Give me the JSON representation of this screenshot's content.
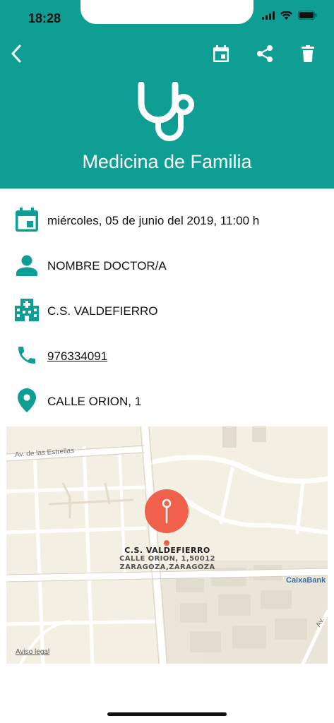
{
  "status_bar": {
    "time": "18:28"
  },
  "header": {
    "title": "Medicina de Familia",
    "background_color": "#0e9e94",
    "actions": {
      "back_icon": "chevron-left-icon",
      "calendar_icon": "calendar-event-icon",
      "share_icon": "share-icon",
      "delete_icon": "trash-icon"
    },
    "logo_icon": "stethoscope-icon"
  },
  "details": {
    "datetime": "miércoles, 05 de junio del 2019, 11:00 h",
    "doctor": "NOMBRE DOCTOR/A",
    "center": "C.S. VALDEFIERRO",
    "phone": "976334091",
    "address": "CALLE ORION, 1",
    "icon_color": "#0e9e94"
  },
  "map": {
    "street_label": "Av. de las Estrellas",
    "pin_title": "C.S. VALDEFIERRO",
    "pin_address_line1": "CALLE ORION, 1,50012",
    "pin_address_line2": "ZARAGOZA,ZARAGOZA",
    "poi_label": "CaixaBank",
    "street_label_right": "Av.",
    "legal_label": "Aviso legal",
    "pin_color": "#f0604a"
  }
}
